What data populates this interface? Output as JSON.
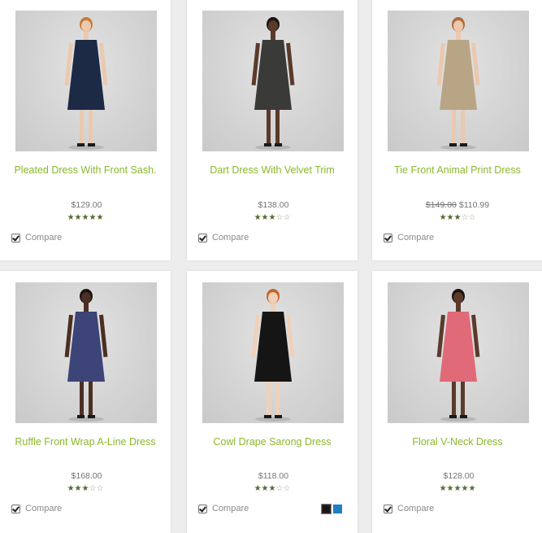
{
  "compare_label": "Compare",
  "products": [
    {
      "name": "Pleated Dress With Front Sash.",
      "price": "$129.00",
      "old_price": "",
      "rating": 4.5,
      "dress_color": "#1c2a45"
    },
    {
      "name": "Dart Dress With Velvet Trim",
      "price": "$138.00",
      "old_price": "",
      "rating": 3,
      "dress_color": "#3a3b38"
    },
    {
      "name": "Tie Front Animal Print Dress",
      "price": "$110.99",
      "old_price": "$149.00",
      "rating": 3,
      "dress_color": "#b8a585"
    },
    {
      "name": "Ruffle Front Wrap A-Line Dress",
      "price": "$168.00",
      "old_price": "",
      "rating": 2.5,
      "dress_color": "#3c4478"
    },
    {
      "name": "Cowl Drape Sarong Dress",
      "price": "$118.00",
      "old_price": "",
      "rating": 2.5,
      "dress_color": "#151515",
      "swatches": [
        {
          "color": "#161616",
          "selected": true
        },
        {
          "color": "#1e7fc3",
          "selected": false
        }
      ]
    },
    {
      "name": "Floral V-Neck Dress",
      "price": "$128.00",
      "old_price": "",
      "rating": 4.5,
      "dress_color": "#e06a78"
    }
  ]
}
